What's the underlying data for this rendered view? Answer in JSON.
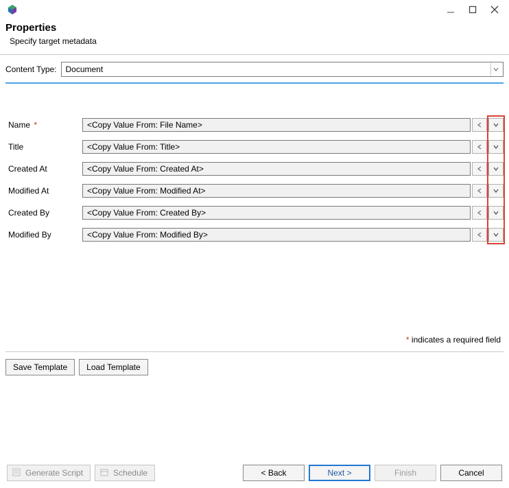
{
  "window": {
    "title": ""
  },
  "header": {
    "title": "Properties",
    "subtitle": "Specify target metadata"
  },
  "contentType": {
    "label": "Content Type:",
    "value": "Document"
  },
  "fields": [
    {
      "label": "Name",
      "required": true,
      "value": "<Copy Value From: File Name>"
    },
    {
      "label": "Title",
      "required": false,
      "value": "<Copy Value From: Title>"
    },
    {
      "label": "Created At",
      "required": false,
      "value": "<Copy Value From: Created At>"
    },
    {
      "label": "Modified At",
      "required": false,
      "value": "<Copy Value From: Modified At>"
    },
    {
      "label": "Created By",
      "required": false,
      "value": "<Copy Value From: Created By>"
    },
    {
      "label": "Modified By",
      "required": false,
      "value": "<Copy Value From: Modified By>"
    }
  ],
  "requiredNote": {
    "star": "*",
    "text": " indicates a required field"
  },
  "templateButtons": {
    "save": "Save Template",
    "load": "Load Template"
  },
  "footer": {
    "generateScript": "Generate Script",
    "schedule": "Schedule",
    "back": "< Back",
    "next": "Next >",
    "finish": "Finish",
    "cancel": "Cancel"
  }
}
